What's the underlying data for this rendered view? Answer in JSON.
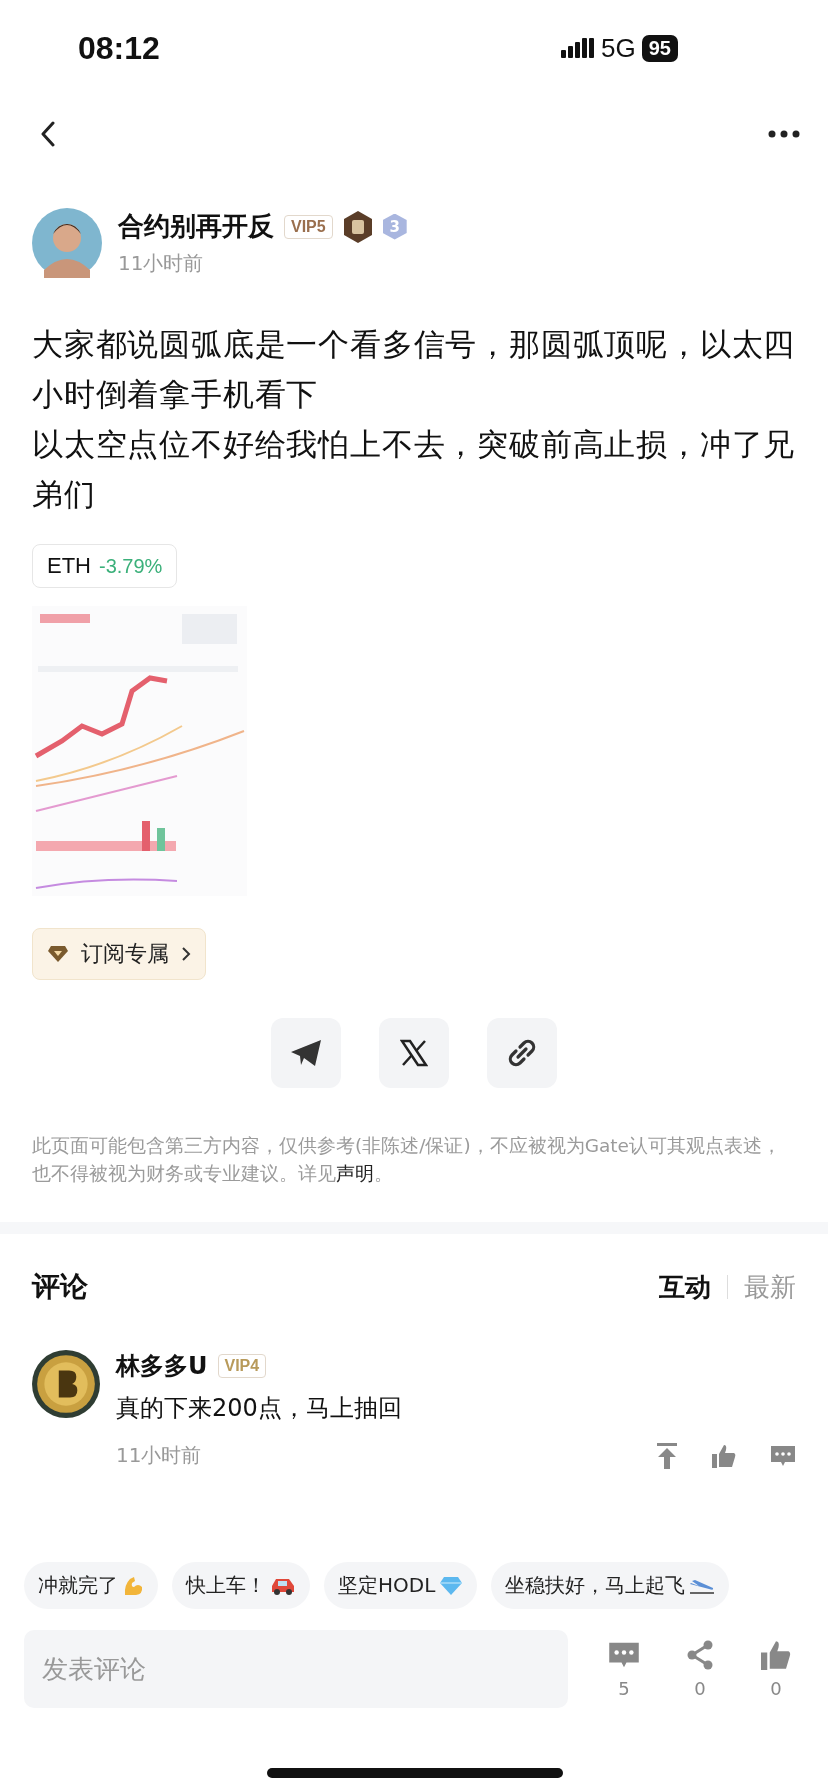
{
  "status_bar": {
    "time": "08:12",
    "network": "5G",
    "battery": "95"
  },
  "post": {
    "author": "合约别再开反",
    "vip": "VIP5",
    "rank": "3",
    "time": "11小时前",
    "paragraphs": [
      "大家都说圆弧底是一个看多信号，那圆弧顶呢，以太四小时倒着拿手机看下",
      "以太空点位不好给我怕上不去，突破前高止损，冲了兄弟们"
    ],
    "ticker": {
      "symbol": "ETH",
      "change": "-3.79%"
    },
    "image": {
      "kind": "picture"
    },
    "subscribe": "订阅专属"
  },
  "disclaimer": {
    "text": "此页面可能包含第三方内容，仅供参考(非陈述/保证)，不应被视为Gate认可其观点表述，也不得被视为财务或专业建议。详见",
    "link": "声明",
    "end": "。"
  },
  "comments": {
    "title": "评论",
    "sort_tabs": [
      {
        "label": "互动",
        "selected": true
      },
      {
        "label": "最新",
        "selected": false
      }
    ],
    "items": [
      {
        "author": "林多多U",
        "vip": "VIP4",
        "text": "真的下来200点，马上抽回",
        "time": "11小时前"
      }
    ]
  },
  "quick_replies": [
    "冲就完了",
    "快上车！",
    "坚定HODL",
    "坐稳扶好，马上起飞"
  ],
  "composer": {
    "placeholder": "发表评论",
    "actions": [
      {
        "kind": "comment",
        "count": "5"
      },
      {
        "kind": "share",
        "count": "0"
      },
      {
        "kind": "like",
        "count": "0"
      }
    ]
  }
}
